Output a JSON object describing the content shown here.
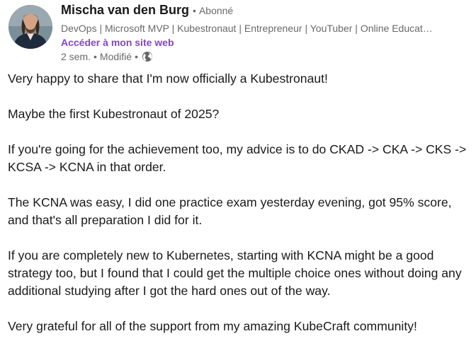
{
  "author": {
    "name": "Mischa van den Burg",
    "separator": "•",
    "follow_status": "Abonné",
    "headline": "DevOps | Microsoft MVP | Kubestronaut | Entrepreneur | YouTuber | Online Educat…",
    "website_link": "Accéder à mon site web",
    "avatar_icon": "person-avatar-icon"
  },
  "meta": {
    "time": "2 sem.",
    "separator": "•",
    "edited": "Modifié",
    "separator_2": "•",
    "visibility_icon": "globe-icon"
  },
  "colors": {
    "link": "#8344cc",
    "muted": "#666666",
    "text": "#191919"
  },
  "post": {
    "paragraphs": [
      "Very happy to share that I'm now officially a Kubestronaut!",
      "Maybe the first Kubestronaut of 2025?",
      "If you're going for the achievement too, my advice is to do CKAD -> CKA -> CKS -> KCSA -> KCNA in that order.",
      "The KCNA was easy, I did one practice exam yesterday evening, got 95% score, and that's all preparation I did for it.",
      "If you are completely new to Kubernetes, starting with KCNA might be a good strategy too, but I found that I could get the multiple choice ones without doing any additional studying after I got the hard ones out of the way.",
      "Very grateful for all of the support from my amazing KubeCraft community!"
    ]
  }
}
